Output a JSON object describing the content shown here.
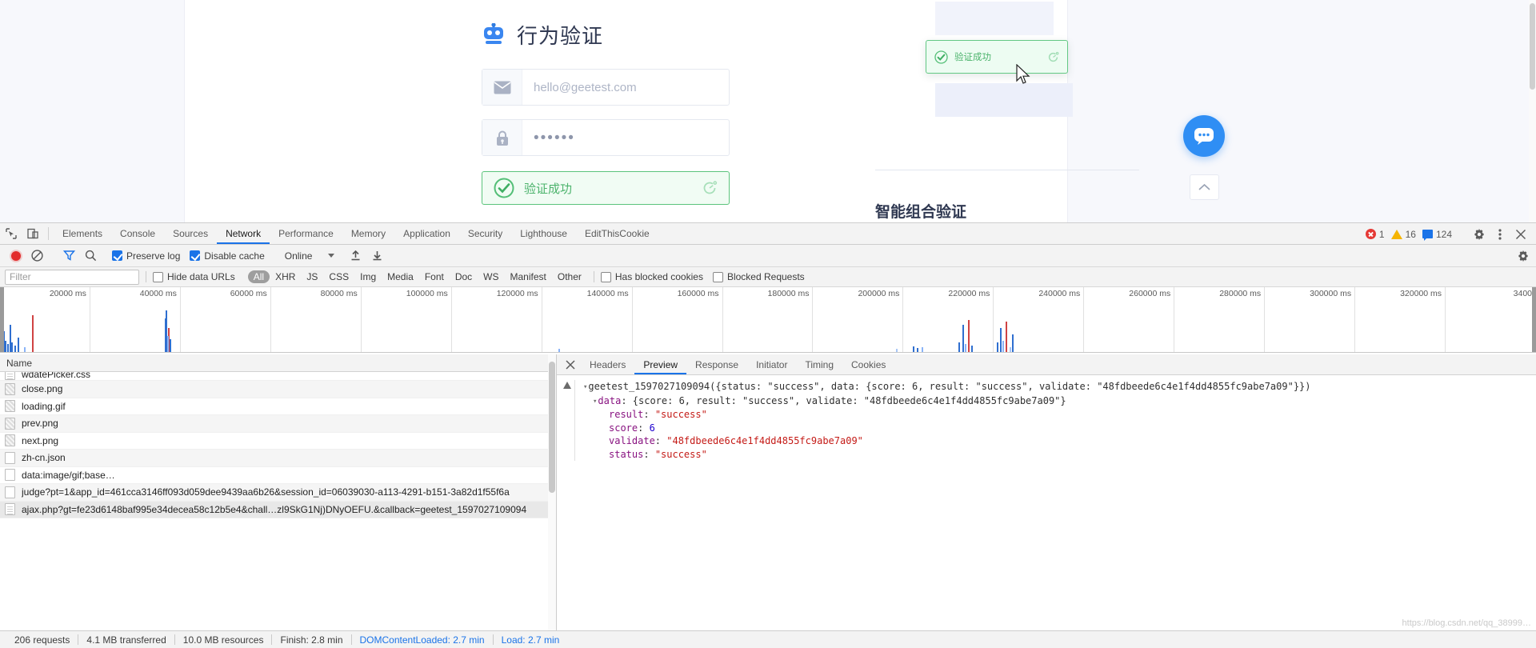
{
  "page": {
    "brand_title": "行为验证",
    "brand_icon": "robot-icon",
    "email_placeholder": "hello@geetest.com",
    "email_value": "",
    "password_value": "••••••",
    "captcha_success_label": "验证成功",
    "popup_success_label": "验证成功",
    "sub_heading": "智能组合验证",
    "fab_chat_icon": "chat-bubble-icon",
    "fab_up_icon": "chevron-up-icon"
  },
  "devtools": {
    "tabs": [
      {
        "label": "Elements",
        "active": false
      },
      {
        "label": "Console",
        "active": false
      },
      {
        "label": "Sources",
        "active": false
      },
      {
        "label": "Network",
        "active": true
      },
      {
        "label": "Performance",
        "active": false
      },
      {
        "label": "Memory",
        "active": false
      },
      {
        "label": "Application",
        "active": false
      },
      {
        "label": "Security",
        "active": false
      },
      {
        "label": "Lighthouse",
        "active": false
      },
      {
        "label": "EditThisCookie",
        "active": false
      }
    ],
    "counters": {
      "errors": "1",
      "warnings": "16",
      "info": "124"
    },
    "netbar": {
      "record_icon": "record-stop-icon",
      "clear_icon": "clear-no-entry-icon",
      "filter_icon": "funnel-filter-icon",
      "search_icon": "search-icon",
      "preserve_log_label": "Preserve log",
      "preserve_log_checked": true,
      "disable_cache_label": "Disable cache",
      "disable_cache_checked": true,
      "throttle_value": "Online",
      "import_icon": "upload-arrow-icon",
      "export_icon": "download-arrow-icon",
      "settings_icon": "gear-icon"
    },
    "filterbar": {
      "filter_placeholder": "Filter",
      "filter_value": "",
      "hide_data_urls_label": "Hide data URLs",
      "hide_data_urls_checked": false,
      "types": [
        "All",
        "XHR",
        "JS",
        "CSS",
        "Img",
        "Media",
        "Font",
        "Doc",
        "WS",
        "Manifest",
        "Other"
      ],
      "types_active": "All",
      "has_blocked_cookies_label": "Has blocked cookies",
      "has_blocked_cookies_checked": false,
      "blocked_requests_label": "Blocked Requests",
      "blocked_requests_checked": false
    },
    "timeline": {
      "ticks": [
        "20000 ms",
        "40000 ms",
        "60000 ms",
        "80000 ms",
        "100000 ms",
        "120000 ms",
        "140000 ms",
        "160000 ms",
        "180000 ms",
        "200000 ms",
        "220000 ms",
        "240000 ms",
        "260000 ms",
        "280000 ms",
        "300000 ms",
        "320000 ms",
        "3400"
      ]
    },
    "request_list": {
      "column_header": "Name",
      "rows": [
        {
          "name": "wdatePicker.css",
          "icon": "stylesheet-file-icon",
          "clipped": true,
          "selected": false
        },
        {
          "name": "close.png",
          "icon": "image-file-icon",
          "clipped": false,
          "selected": false
        },
        {
          "name": "loading.gif",
          "icon": "image-file-icon",
          "clipped": false,
          "selected": false
        },
        {
          "name": "prev.png",
          "icon": "image-file-icon",
          "clipped": false,
          "selected": false
        },
        {
          "name": "next.png",
          "icon": "image-file-icon",
          "clipped": false,
          "selected": false
        },
        {
          "name": "zh-cn.json",
          "icon": "generic-file-icon",
          "clipped": false,
          "selected": false
        },
        {
          "name": "data:image/gif;base…",
          "icon": "generic-file-icon",
          "clipped": false,
          "selected": false
        },
        {
          "name": "judge?pt=1&app_id=461cca3146ff093d059dee9439aa6b26&session_id=06039030-a113-4291-b151-3a82d1f55f6a",
          "icon": "generic-file-icon",
          "clipped": false,
          "selected": false
        },
        {
          "name": "ajax.php?gt=fe23d6148baf995e34decea58c12b5e4&chall…zl9SkG1Nj)DNyOEFU.&callback=geetest_1597027109094",
          "icon": "script-file-icon",
          "clipped": false,
          "selected": true
        }
      ]
    },
    "detail": {
      "close_icon": "close-icon",
      "tabs": [
        {
          "label": "Headers",
          "active": false
        },
        {
          "label": "Preview",
          "active": true
        },
        {
          "label": "Response",
          "active": false
        },
        {
          "label": "Initiator",
          "active": false
        },
        {
          "label": "Timing",
          "active": false
        },
        {
          "label": "Cookies",
          "active": false
        }
      ],
      "preview": {
        "root_line": "geetest_1597027109094({status: \"success\", data: {score: 6, result: \"success\", validate: \"48fdbeede6c4e1f4dd4855fc9abe7a09\"}})",
        "data_line": "data: {score: 6, result: \"success\", validate: \"48fdbeede6c4e1f4dd4855fc9abe7a09\"}",
        "entries": [
          {
            "key": "result",
            "value": "\"success\"",
            "kind": "string"
          },
          {
            "key": "score",
            "value": "6",
            "kind": "number"
          },
          {
            "key": "validate",
            "value": "\"48fdbeede6c4e1f4dd4855fc9abe7a09\"",
            "kind": "string"
          },
          {
            "key": "status",
            "value": "\"success\"",
            "kind": "string"
          }
        ]
      }
    },
    "status": {
      "requests": "206 requests",
      "transferred": "4.1 MB transferred",
      "resources": "10.0 MB resources",
      "finish": "Finish: 2.8 min",
      "dom_loaded": "DOMContentLoaded: 2.7 min",
      "load": "Load: 2.7 min"
    },
    "watermark": "https://blog.csdn.net/qq_38999…"
  }
}
